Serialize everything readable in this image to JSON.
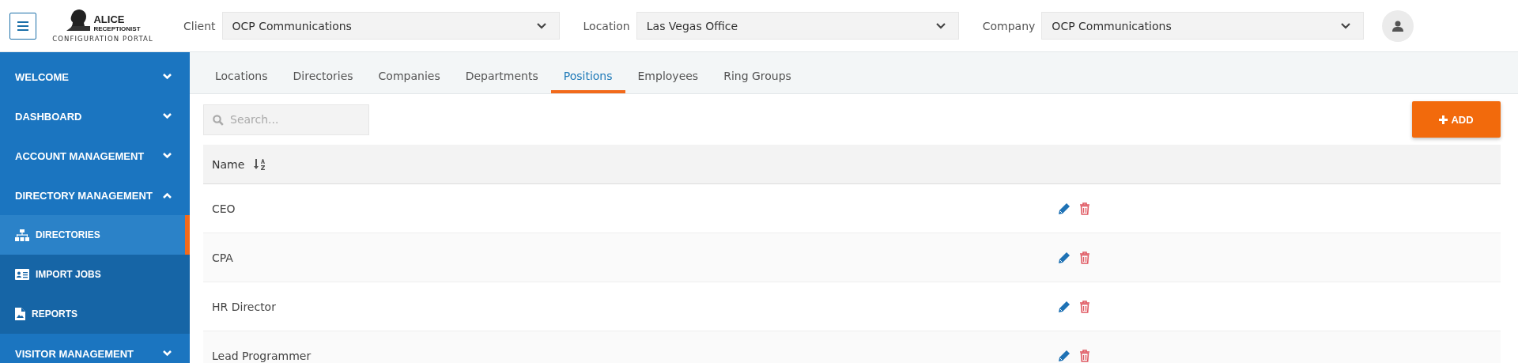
{
  "header": {
    "logo": {
      "title": "ALICE",
      "subtitle": "RECEPTIONIST",
      "caption": "CONFIGURATION PORTAL"
    },
    "filters": [
      {
        "label": "Client",
        "value": "OCP Communications"
      },
      {
        "label": "Location",
        "value": "Las Vegas Office"
      },
      {
        "label": "Company",
        "value": "OCP Communications"
      }
    ]
  },
  "sidebar": {
    "items": [
      {
        "label": "WELCOME",
        "expanded": false
      },
      {
        "label": "DASHBOARD",
        "expanded": false
      },
      {
        "label": "ACCOUNT MANAGEMENT",
        "expanded": false
      },
      {
        "label": "DIRECTORY MANAGEMENT",
        "expanded": true,
        "children": [
          {
            "label": "DIRECTORIES",
            "selected": true
          },
          {
            "label": "IMPORT JOBS",
            "selected": false
          },
          {
            "label": "REPORTS",
            "selected": false
          }
        ]
      },
      {
        "label": "VISITOR MANAGEMENT",
        "expanded": false
      }
    ]
  },
  "tabs": [
    {
      "label": "Locations",
      "selected": false
    },
    {
      "label": "Directories",
      "selected": false
    },
    {
      "label": "Companies",
      "selected": false
    },
    {
      "label": "Departments",
      "selected": false
    },
    {
      "label": "Positions",
      "selected": true
    },
    {
      "label": "Employees",
      "selected": false
    },
    {
      "label": "Ring Groups",
      "selected": false
    }
  ],
  "search": {
    "placeholder": "Search..."
  },
  "add_button": {
    "label": "ADD"
  },
  "table": {
    "columns": [
      {
        "label": "Name"
      }
    ],
    "rows": [
      {
        "name": "CEO"
      },
      {
        "name": "CPA"
      },
      {
        "name": "HR Director"
      },
      {
        "name": "Lead Programmer"
      }
    ]
  }
}
